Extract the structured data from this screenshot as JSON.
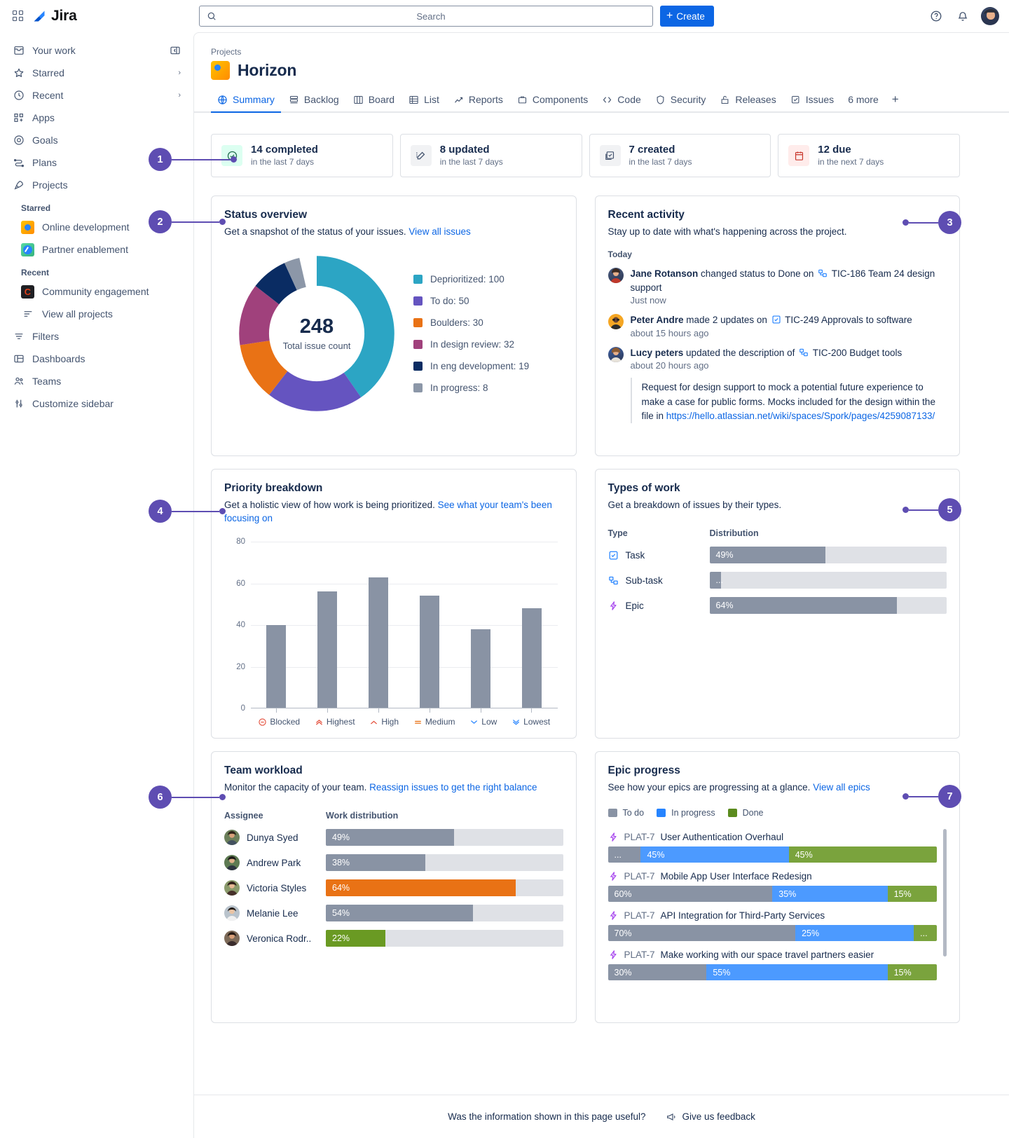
{
  "brand": {
    "name": "Jira",
    "apps_icon": "apps-grid-icon"
  },
  "search": {
    "placeholder": "Search",
    "icon": "search-icon"
  },
  "topbar": {
    "create_label": "Create",
    "help_icon": "help-circle-icon",
    "notifications_icon": "bell-icon",
    "avatar": "user-avatar"
  },
  "sidebar": {
    "items": [
      {
        "label": "Your work",
        "icon": "inbox-icon",
        "trailing": "collapse-panel-icon"
      },
      {
        "label": "Starred",
        "icon": "star-icon",
        "trailing": "chevron-right-icon"
      },
      {
        "label": "Recent",
        "icon": "clock-icon",
        "trailing": "chevron-right-icon"
      },
      {
        "label": "Apps",
        "icon": "apps-plus-icon",
        "trailing": ""
      },
      {
        "label": "Goals",
        "icon": "target-icon",
        "trailing": ""
      },
      {
        "label": "Plans",
        "icon": "plans-icon",
        "trailing": ""
      },
      {
        "label": "Projects",
        "icon": "rocket-icon",
        "trailing": ""
      }
    ],
    "starred_label": "Starred",
    "starred_projects": [
      {
        "label": "Online development",
        "icon": "project-avatar-horizon"
      },
      {
        "label": "Partner enablement",
        "icon": "project-avatar-partner"
      }
    ],
    "recent_label": "Recent",
    "recent_projects": [
      {
        "label": "Community engagement",
        "icon": "project-avatar-community"
      }
    ],
    "view_all_projects": {
      "label": "View all projects",
      "icon": "list-icon"
    },
    "bottom_items": [
      {
        "label": "Filters",
        "icon": "filter-icon"
      },
      {
        "label": "Dashboards",
        "icon": "dashboard-icon"
      },
      {
        "label": "Teams",
        "icon": "people-icon"
      },
      {
        "label": "Customize sidebar",
        "icon": "sliders-icon"
      }
    ]
  },
  "page": {
    "breadcrumb": "Projects",
    "title": "Horizon",
    "avatar": "project-avatar-horizon",
    "tabs": [
      {
        "label": "Summary",
        "icon": "globe-icon",
        "active": true
      },
      {
        "label": "Backlog",
        "icon": "backlog-icon",
        "active": false
      },
      {
        "label": "Board",
        "icon": "board-icon",
        "active": false
      },
      {
        "label": "List",
        "icon": "list-grid-icon",
        "active": false
      },
      {
        "label": "Reports",
        "icon": "chart-line-icon",
        "active": false
      },
      {
        "label": "Components",
        "icon": "components-icon",
        "active": false
      },
      {
        "label": "Code",
        "icon": "code-icon",
        "active": false
      },
      {
        "label": "Security",
        "icon": "shield-icon",
        "active": false
      },
      {
        "label": "Releases",
        "icon": "releases-icon",
        "active": false
      },
      {
        "label": "Issues",
        "icon": "issues-icon",
        "active": false
      }
    ],
    "more_tabs_label": "6 more",
    "add_tab_icon": "plus-icon"
  },
  "stats": [
    {
      "value": "14 completed",
      "sub": "in the last 7 days",
      "icon": "check-circle-icon",
      "tone": "green"
    },
    {
      "value": "8 updated",
      "sub": "in the last 7 days",
      "icon": "pencil-icon",
      "tone": "grey"
    },
    {
      "value": "7 created",
      "sub": "in the last 7 days",
      "icon": "copy-check-icon",
      "tone": "grey"
    },
    {
      "value": "12 due",
      "sub": "in the next 7 days",
      "icon": "calendar-icon",
      "tone": "red"
    }
  ],
  "status_overview": {
    "title": "Status overview",
    "desc": "Get a snapshot of the status of your issues.",
    "link": "View all issues",
    "center_value": "248",
    "center_label": "Total issue count"
  },
  "recent_activity": {
    "title": "Recent activity",
    "desc": "Stay up to date with what's happening across the project.",
    "day_label": "Today",
    "items": [
      {
        "who": "Jane Rotanson",
        "action": "changed status to Done on",
        "issue_type": "subtask-icon",
        "issue_key": "TIC-186",
        "issue_title": "Team 24 design support",
        "time": "Just now"
      },
      {
        "who": "Peter Andre",
        "action": "made 2 updates on",
        "issue_type": "task-icon",
        "issue_key": "TIC-249",
        "issue_title": "Approvals to software",
        "time": "about 15 hours ago"
      },
      {
        "who": "Lucy peters",
        "action": "updated the description of",
        "issue_type": "subtask-icon",
        "issue_key": "TIC-200",
        "issue_title": "Budget tools",
        "time": "about 20 hours ago",
        "quote_text": "Request for design support to mock a potential future experience to make a case for public forms. Mocks included for the design within the file in ",
        "quote_link": "https://hello.atlassian.net/wiki/spaces/Spork/pages/4259087133/"
      }
    ]
  },
  "priority_breakdown": {
    "title": "Priority breakdown",
    "desc": "Get a holistic view of how work is being prioritized.",
    "link": "See what your team's been focusing on"
  },
  "types_of_work": {
    "title": "Types of work",
    "desc": "Get a breakdown of issues by their types.",
    "col_type": "Type",
    "col_distribution": "Distribution",
    "rows": [
      {
        "label": "Task",
        "icon": "task-icon",
        "value": 49,
        "value_label": "49%",
        "tone": "grey"
      },
      {
        "label": "Sub-task",
        "icon": "subtask-icon",
        "value": 5,
        "value_label": "...",
        "tone": "grey"
      },
      {
        "label": "Epic",
        "icon": "epic-icon",
        "value": 64,
        "value_label": "64%",
        "tone": "grey"
      }
    ]
  },
  "team_workload": {
    "title": "Team workload",
    "desc": "Monitor the capacity of your team.",
    "link": "Reassign issues to get the right balance",
    "col_assignee": "Assignee",
    "col_distribution": "Work distribution",
    "rows": [
      {
        "name": "Dunya Syed",
        "value": 49,
        "value_label": "49%",
        "tone": "grey"
      },
      {
        "name": "Andrew Park",
        "value": 38,
        "value_label": "38%",
        "tone": "grey"
      },
      {
        "name": "Victoria Styles",
        "value": 64,
        "value_label": "64%",
        "tone": "orange"
      },
      {
        "name": "Melanie Lee",
        "value": 54,
        "value_label": "54%",
        "tone": "grey"
      },
      {
        "name": "Veronica Rodr..",
        "value": 22,
        "value_label": "22%",
        "tone": "green"
      }
    ]
  },
  "epic_progress": {
    "title": "Epic progress",
    "desc": "See how your epics are progressing at a glance.",
    "link": "View all epics",
    "legend": [
      {
        "label": "To do",
        "color": "#8993A4"
      },
      {
        "label": "In progress",
        "color": "#2684FF"
      },
      {
        "label": "Done",
        "color": "#5B8B1E"
      }
    ],
    "epics": [
      {
        "key": "PLAT-7",
        "title": "User Authentication Overhaul",
        "icon": "epic-icon",
        "segments": [
          {
            "label": "...",
            "value": 10,
            "kind": "todo"
          },
          {
            "label": "45%",
            "value": 45,
            "kind": "prog"
          },
          {
            "label": "45%",
            "value": 45,
            "kind": "done"
          }
        ]
      },
      {
        "key": "PLAT-7",
        "title": "Mobile App User Interface Redesign",
        "icon": "epic-icon",
        "segments": [
          {
            "label": "60%",
            "value": 60,
            "kind": "todo"
          },
          {
            "label": "35%",
            "value": 35,
            "kind": "prog"
          },
          {
            "label": "15%",
            "value": 15,
            "kind": "done"
          }
        ]
      },
      {
        "key": "PLAT-7",
        "title": "API Integration for Third-Party Services",
        "icon": "epic-icon",
        "segments": [
          {
            "label": "70%",
            "value": 70,
            "kind": "todo"
          },
          {
            "label": "25%",
            "value": 25,
            "kind": "prog"
          },
          {
            "label": "...",
            "value": 7,
            "kind": "done"
          }
        ]
      },
      {
        "key": "PLAT-7",
        "title": "Make working with our space travel partners easier",
        "icon": "epic-icon",
        "segments": [
          {
            "label": "30%",
            "value": 30,
            "kind": "todo"
          },
          {
            "label": "55%",
            "value": 55,
            "kind": "prog"
          },
          {
            "label": "15%",
            "value": 15,
            "kind": "done"
          }
        ]
      }
    ]
  },
  "footer": {
    "question": "Was the information shown in this page useful?",
    "feedback_label": "Give us feedback",
    "feedback_icon": "megaphone-icon"
  },
  "markers": [
    "1",
    "2",
    "3",
    "4",
    "5",
    "6",
    "7"
  ],
  "colors": {
    "accent_blue": "#0C66E4",
    "marker_purple": "#5E4DB2",
    "bar_grey": "#8993A4",
    "bar_orange": "#E97215",
    "bar_green": "#6A9A23"
  },
  "chart_data": [
    {
      "type": "pie",
      "title": "Status overview",
      "total": 248,
      "center_label": "Total issue count",
      "legend_position": "right",
      "categories": [
        "Deprioritized",
        "To do",
        "Boulders",
        "In design review",
        "In eng development",
        "In progress"
      ],
      "values": [
        100,
        50,
        30,
        32,
        19,
        8
      ],
      "labels": [
        "Deprioritized: 100",
        "To do: 50",
        "Boulders: 30",
        "In design review: 32",
        "In eng development: 19",
        "In progress: 8"
      ],
      "colors": [
        "#2CA5C4",
        "#6554C0",
        "#E97215",
        "#A0417C",
        "#0A2C63",
        "#8C97A8"
      ]
    },
    {
      "type": "bar",
      "title": "Priority breakdown",
      "categories": [
        "Blocked",
        "Highest",
        "High",
        "Medium",
        "Low",
        "Lowest"
      ],
      "values": [
        40,
        56,
        63,
        54,
        38,
        48
      ],
      "xlabel": "",
      "ylabel": "",
      "ylim": [
        0,
        80
      ],
      "yticks": [
        0,
        20,
        40,
        60,
        80
      ],
      "grid": true,
      "bar_color": "#8993A4"
    },
    {
      "type": "bar",
      "title": "Types of work",
      "orientation": "horizontal",
      "categories": [
        "Task",
        "Sub-task",
        "Epic"
      ],
      "values": [
        49,
        5,
        64
      ],
      "value_labels": [
        "49%",
        "...",
        "64%"
      ],
      "xlim": [
        0,
        100
      ]
    },
    {
      "type": "bar",
      "title": "Team workload",
      "orientation": "horizontal",
      "categories": [
        "Dunya Syed",
        "Andrew Park",
        "Victoria Styles",
        "Melanie Lee",
        "Veronica Rodr.."
      ],
      "values": [
        49,
        38,
        64,
        54,
        22
      ],
      "value_labels": [
        "49%",
        "38%",
        "64%",
        "54%",
        "22%"
      ],
      "xlim": [
        0,
        100
      ]
    },
    {
      "type": "bar",
      "title": "Epic progress",
      "orientation": "horizontal",
      "stacked": true,
      "categories": [
        "User Authentication Overhaul",
        "Mobile App User Interface Redesign",
        "API Integration for Third-Party Services",
        "Make working with our space travel partners easier"
      ],
      "series": [
        {
          "name": "To do",
          "values": [
            10,
            60,
            70,
            30
          ]
        },
        {
          "name": "In progress",
          "values": [
            45,
            35,
            25,
            55
          ]
        },
        {
          "name": "Done",
          "values": [
            45,
            15,
            7,
            15
          ]
        }
      ]
    }
  ]
}
